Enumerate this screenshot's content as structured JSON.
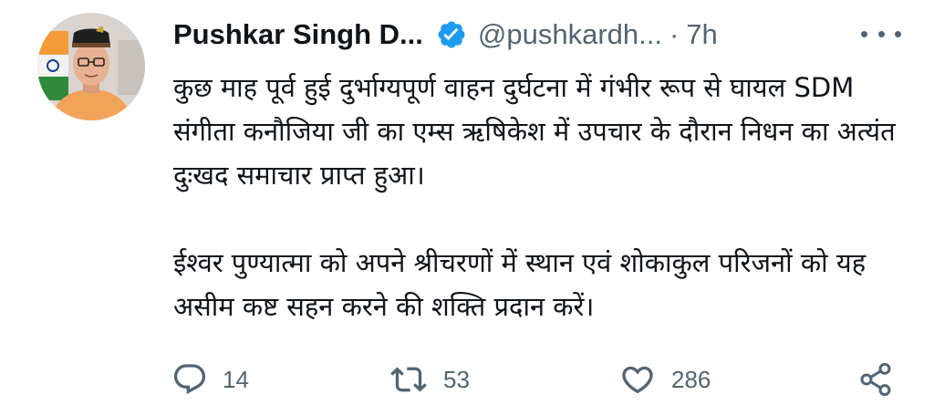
{
  "tweet": {
    "author_name": "Pushkar Singh D...",
    "handle": "@pushkardh...",
    "separator": "·",
    "time": "7h",
    "paragraphs": [
      "कुछ माह पूर्व हुई दुर्भाग्यपूर्ण वाहन दुर्घटना में गंभीर रूप से घायल SDM संगीता कनौजिया जी का एम्स ऋषिकेश में उपचार के दौरान निधन का अत्यंत दुःखद समाचार प्राप्त हुआ।",
      "ईश्वर पुण्यात्मा को अपने श्रीचरणों में स्थान एवं शोकाकुल परिजनों को यह असीम कष्ट सहन करने की शक्ति प्रदान करें।"
    ],
    "verified": true
  },
  "actions": {
    "reply": {
      "icon": "reply-icon",
      "count": "14"
    },
    "retweet": {
      "icon": "retweet-icon",
      "count": "53"
    },
    "like": {
      "icon": "heart-icon",
      "count": "286"
    },
    "share": {
      "icon": "share-icon"
    }
  },
  "colors": {
    "text": "#0f1419",
    "secondary": "#536471",
    "verified": "#1d9bf0",
    "background": "#ffffff"
  }
}
